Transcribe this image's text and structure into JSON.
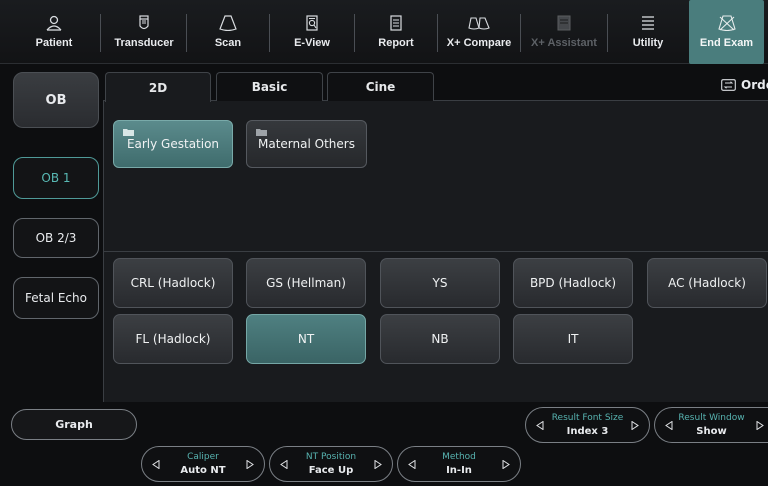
{
  "toolbar": {
    "items": [
      {
        "label": "Patient",
        "icon": "patient-icon"
      },
      {
        "label": "Transducer",
        "icon": "transducer-icon"
      },
      {
        "label": "Scan",
        "icon": "scan-icon"
      },
      {
        "label": "E-View",
        "icon": "eview-icon"
      },
      {
        "label": "Report",
        "icon": "report-icon"
      },
      {
        "label": "X+ Compare",
        "icon": "compare-icon"
      },
      {
        "label": "X+ Assistant",
        "icon": "assistant-icon",
        "disabled": true
      },
      {
        "label": "Utility",
        "icon": "utility-icon"
      },
      {
        "label": "End Exam",
        "icon": "end-exam-icon",
        "accent": "#4a7d7d"
      }
    ]
  },
  "left": {
    "exam_type": "OB",
    "items": [
      "OB 1",
      "OB 2/3",
      "Fetal Echo"
    ],
    "selected_item": "OB 1"
  },
  "tabs": {
    "items": [
      "2D",
      "Basic",
      "Cine"
    ],
    "active": "2D"
  },
  "order_label": "Orde",
  "folders": {
    "items": [
      "Early Gestation",
      "Maternal Others"
    ],
    "active": "Early Gestation"
  },
  "measurements": {
    "items": [
      "CRL (Hadlock)",
      "GS (Hellman)",
      "YS",
      "BPD (Hadlock)",
      "AC (Hadlock)",
      "FL (Hadlock)",
      "NT",
      "NB",
      "IT"
    ],
    "active": "NT"
  },
  "bottom": {
    "graph_label": "Graph",
    "controls": {
      "caliper": {
        "title": "Caliper",
        "value": "Auto NT"
      },
      "nt_position": {
        "title": "NT Position",
        "value": "Face Up"
      },
      "method": {
        "title": "Method",
        "value": "In-In"
      },
      "result_font_size": {
        "title": "Result Font Size",
        "value": "Index 3"
      },
      "result_window": {
        "title": "Result Window",
        "value": "Show"
      }
    }
  },
  "colors": {
    "accent_teal": "#4a7d7d",
    "selected_text": "#58b9b4",
    "background": "#0d0e10"
  }
}
